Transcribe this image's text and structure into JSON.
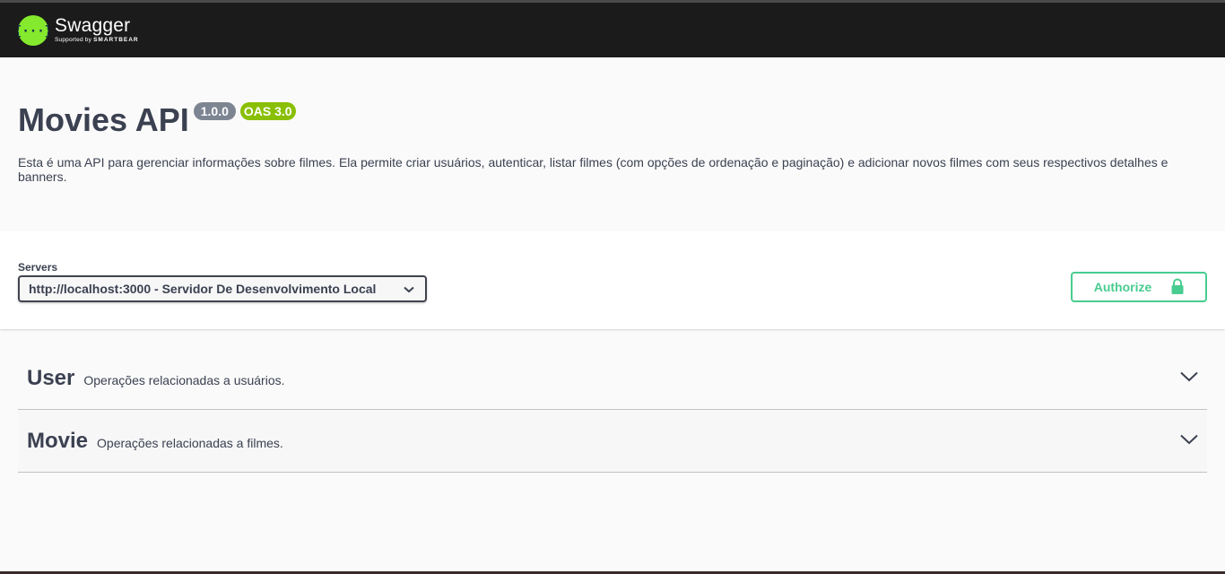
{
  "header": {
    "brand": "Swagger",
    "tagline_prefix": "Supported by",
    "tagline_brand": "SMARTBEAR",
    "logo_icon": "swagger-logo-icon",
    "colors": {
      "bar": "#1b1b1b",
      "logo": "#85ea2d"
    }
  },
  "info": {
    "title": "Movies API",
    "version": "1.0.0",
    "oas": "OAS 3.0",
    "description": "Esta é uma API para gerenciar informações sobre filmes. Ela permite criar usuários, autenticar, listar filmes (com opções de ordenação e paginação) e adicionar novos filmes com seus respectivos detalhes e banners."
  },
  "servers": {
    "label": "Servers",
    "selected": "http://localhost:3000 - Servidor De Desenvolvimento Local",
    "icon": "chevron-down-icon"
  },
  "authorize": {
    "label": "Authorize",
    "icon": "lock-icon",
    "color": "#49cc90"
  },
  "tags": [
    {
      "name": "User",
      "description": "Operações relacionadas a usuários.",
      "icon": "chevron-down-icon"
    },
    {
      "name": "Movie",
      "description": "Operações relacionadas a filmes.",
      "icon": "chevron-down-icon"
    }
  ]
}
